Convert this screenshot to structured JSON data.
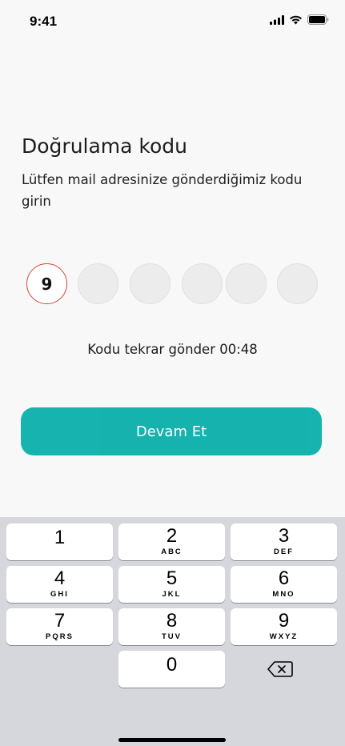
{
  "status_bar": {
    "time": "9:41"
  },
  "page": {
    "title": "Doğrulama kodu",
    "subtitle": "Lütfen mail adresinize gönderdiğimiz kodu girin"
  },
  "otp": {
    "digits": [
      "9",
      "",
      "",
      "",
      "",
      ""
    ],
    "active_index": 0
  },
  "resend": {
    "text": "Kodu tekrar gönder 00:48"
  },
  "cta": {
    "label": "Devam Et",
    "color": "#11b1ad"
  },
  "keypad": {
    "keys": [
      {
        "num": "1",
        "letters": ""
      },
      {
        "num": "2",
        "letters": "ABC"
      },
      {
        "num": "3",
        "letters": "DEF"
      },
      {
        "num": "4",
        "letters": "GHI"
      },
      {
        "num": "5",
        "letters": "JKL"
      },
      {
        "num": "6",
        "letters": "MNO"
      },
      {
        "num": "7",
        "letters": "PQRS"
      },
      {
        "num": "8",
        "letters": "TUV"
      },
      {
        "num": "9",
        "letters": "WXYZ"
      },
      {
        "num": "0",
        "letters": ""
      }
    ],
    "backspace_icon": "backspace-icon"
  },
  "colors": {
    "accent": "#11b1ad",
    "active_border": "#d9403a",
    "keyboard_bg": "#d5d7dc"
  }
}
